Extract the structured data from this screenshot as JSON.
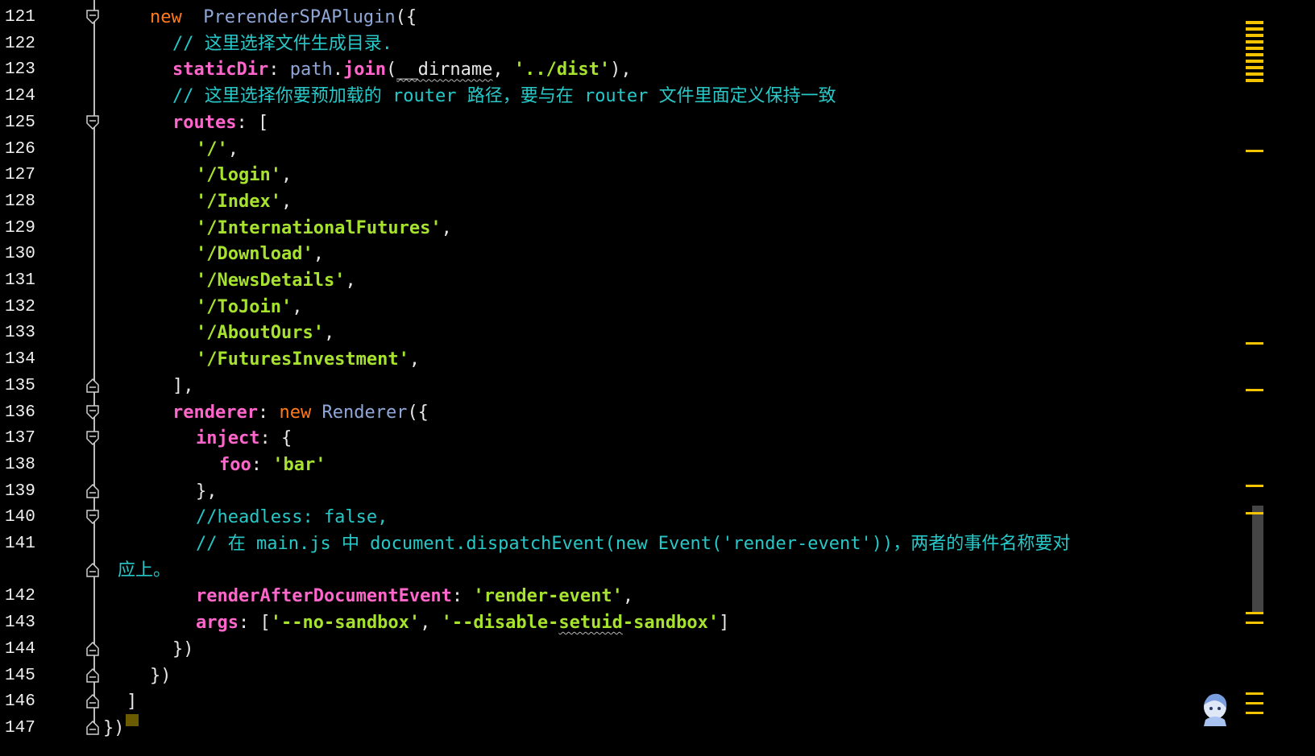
{
  "editor": {
    "lines": [
      {
        "num": "121",
        "fold": "open",
        "html": [
          [
            "kw",
            "new"
          ],
          [
            "",
            "  "
          ],
          [
            "cls",
            "PrerenderSPAPlugin"
          ],
          [
            "punc",
            "({"
          ]
        ],
        "indent": 186
      },
      {
        "num": "122",
        "fold": "",
        "html": [
          [
            "cmt",
            "// 这里选择文件生成目录."
          ]
        ],
        "indent": 214
      },
      {
        "num": "123",
        "fold": "",
        "html": [
          [
            "prop",
            "staticDir"
          ],
          [
            "punc",
            ": "
          ],
          [
            "var",
            "path"
          ],
          [
            "punc",
            "."
          ],
          [
            "fn",
            "join"
          ],
          [
            "punc",
            "("
          ],
          [
            "punc wavy",
            "__dirname"
          ],
          [
            "punc",
            ", "
          ],
          [
            "str",
            "'../dist'"
          ],
          [
            "punc",
            "),"
          ]
        ],
        "indent": 214
      },
      {
        "num": "124",
        "fold": "",
        "html": [
          [
            "cmt",
            "// 这里选择你要预加载的 router 路径，要与在 router 文件里面定义保持一致"
          ]
        ],
        "indent": 214
      },
      {
        "num": "125",
        "fold": "open",
        "html": [
          [
            "prop",
            "routes"
          ],
          [
            "punc",
            ": ["
          ]
        ],
        "indent": 214
      },
      {
        "num": "126",
        "fold": "",
        "html": [
          [
            "str",
            "'/'"
          ],
          [
            "punc",
            ","
          ]
        ],
        "indent": 243
      },
      {
        "num": "127",
        "fold": "",
        "html": [
          [
            "str",
            "'/login'"
          ],
          [
            "punc",
            ","
          ]
        ],
        "indent": 243
      },
      {
        "num": "128",
        "fold": "",
        "html": [
          [
            "str",
            "'/Index'"
          ],
          [
            "punc",
            ","
          ]
        ],
        "indent": 243
      },
      {
        "num": "129",
        "fold": "",
        "html": [
          [
            "str",
            "'/InternationalFutures'"
          ],
          [
            "punc",
            ","
          ]
        ],
        "indent": 243
      },
      {
        "num": "130",
        "fold": "",
        "html": [
          [
            "str",
            "'/Download'"
          ],
          [
            "punc",
            ","
          ]
        ],
        "indent": 243
      },
      {
        "num": "131",
        "fold": "",
        "html": [
          [
            "str",
            "'/NewsDetails'"
          ],
          [
            "punc",
            ","
          ]
        ],
        "indent": 243
      },
      {
        "num": "132",
        "fold": "",
        "html": [
          [
            "str",
            "'/ToJoin'"
          ],
          [
            "punc",
            ","
          ]
        ],
        "indent": 243
      },
      {
        "num": "133",
        "fold": "",
        "html": [
          [
            "str",
            "'/AboutOurs'"
          ],
          [
            "punc",
            ","
          ]
        ],
        "indent": 243
      },
      {
        "num": "134",
        "fold": "",
        "html": [
          [
            "str",
            "'/FuturesInvestment'"
          ],
          [
            "punc",
            ","
          ]
        ],
        "indent": 243
      },
      {
        "num": "135",
        "fold": "close",
        "html": [
          [
            "punc",
            "],"
          ]
        ],
        "indent": 214
      },
      {
        "num": "136",
        "fold": "open",
        "html": [
          [
            "prop",
            "renderer"
          ],
          [
            "punc",
            ": "
          ],
          [
            "kw",
            "new"
          ],
          [
            "punc",
            " "
          ],
          [
            "cls",
            "Renderer"
          ],
          [
            "punc",
            "({"
          ]
        ],
        "indent": 214
      },
      {
        "num": "137",
        "fold": "open",
        "html": [
          [
            "prop",
            "inject"
          ],
          [
            "punc",
            ": {"
          ]
        ],
        "indent": 243
      },
      {
        "num": "138",
        "fold": "",
        "html": [
          [
            "prop",
            "foo"
          ],
          [
            "punc",
            ": "
          ],
          [
            "str",
            "'bar'"
          ]
        ],
        "indent": 272
      },
      {
        "num": "139",
        "fold": "close",
        "html": [
          [
            "punc",
            "},"
          ]
        ],
        "indent": 243
      },
      {
        "num": "140",
        "fold": "open",
        "html": [
          [
            "cmt",
            "//headless: false,"
          ]
        ],
        "indent": 243
      },
      {
        "num": "141",
        "fold": "",
        "html": [
          [
            "cmt",
            "// 在 main.js 中 document.dispatchEvent(new Event('render-event'))，两者的事件名称要对"
          ]
        ],
        "indent": 243
      },
      {
        "num": "",
        "fold": "close",
        "html": [
          [
            "cmt",
            "应上。"
          ]
        ],
        "indent": 146
      },
      {
        "num": "142",
        "fold": "",
        "html": [
          [
            "prop",
            "renderAfterDocumentEvent"
          ],
          [
            "punc",
            ": "
          ],
          [
            "str",
            "'render-event'"
          ],
          [
            "punc",
            ","
          ]
        ],
        "indent": 243
      },
      {
        "num": "143",
        "fold": "",
        "html": [
          [
            "prop",
            "args"
          ],
          [
            "punc",
            ": ["
          ],
          [
            "str",
            "'--no-sandbox'"
          ],
          [
            "punc",
            ", "
          ],
          [
            "str",
            "'--disable-"
          ],
          [
            "str wavy",
            "setuid"
          ],
          [
            "str",
            "-sandbox'"
          ],
          [
            "punc",
            "]"
          ]
        ],
        "indent": 243
      },
      {
        "num": "144",
        "fold": "close",
        "html": [
          [
            "punc",
            "})"
          ]
        ],
        "indent": 214
      },
      {
        "num": "145",
        "fold": "close",
        "html": [
          [
            "punc",
            "})"
          ]
        ],
        "indent": 186
      },
      {
        "num": "146",
        "fold": "close",
        "html": [
          [
            "punc",
            "]"
          ]
        ],
        "indent": 157
      },
      {
        "num": "147",
        "fold": "close",
        "html": [
          [
            "punc",
            "})"
          ]
        ],
        "indent": 128
      }
    ],
    "prev_line_fragment": "]),"
  },
  "scrollbar": {
    "marks_color": "#f5c400"
  }
}
